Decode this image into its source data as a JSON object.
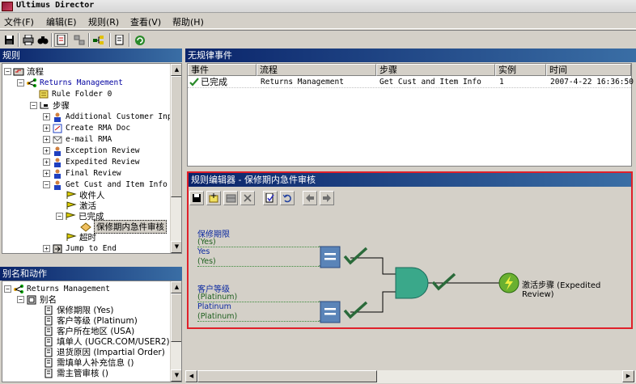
{
  "window": {
    "title": "Ultimus Director"
  },
  "menu": [
    {
      "label": "文件(F)"
    },
    {
      "label": "编辑(E)"
    },
    {
      "label": "规则(R)"
    },
    {
      "label": "查看(V)"
    },
    {
      "label": "帮助(H)"
    }
  ],
  "panes": {
    "rules_title": "规则",
    "events_title": "无规律事件",
    "editor_title": "规则编辑器 - 保修期内急件审核",
    "alias_title": "别名和动作"
  },
  "rules_tree": [
    {
      "label": "流程",
      "zh": true
    },
    {
      "label": "Returns Management",
      "color": "#0000a0"
    },
    {
      "label": "Rule Folder 0"
    },
    {
      "label": "步骤",
      "zh": true
    },
    {
      "label": "Additional Customer Inpu"
    },
    {
      "label": "Create RMA Doc"
    },
    {
      "label": "e-mail RMA"
    },
    {
      "label": "Exception Review"
    },
    {
      "label": "Expedited Review"
    },
    {
      "label": "Final Review"
    },
    {
      "label": "Get Cust and Item Info"
    },
    {
      "label": "收件人",
      "zh": true
    },
    {
      "label": "激活",
      "zh": true
    },
    {
      "label": "已完成",
      "zh": true
    },
    {
      "label": "保修期内急件审核",
      "zh": true
    },
    {
      "label": "超时",
      "zh": true
    },
    {
      "label": "Jump to End"
    }
  ],
  "events_table": {
    "columns": [
      "事件",
      "流程",
      "步骤",
      "实例",
      "时间"
    ],
    "rows": [
      [
        "已完成",
        "Returns Management",
        "Get Cust and Item Info",
        "1",
        "2007-4-22 16:36:50"
      ]
    ]
  },
  "alias_tree": [
    {
      "label": "Returns Management"
    },
    {
      "label": "别名",
      "zh": true
    },
    {
      "label": "保修期限 (Yes)"
    },
    {
      "label": "客户等级 (Platinum)"
    },
    {
      "label": "客户所在地区 (USA)"
    },
    {
      "label": "填单人 (UGCR.COM/USER2)"
    },
    {
      "label": "退货原因 (Impartial Order)"
    },
    {
      "label": "需填单人补充信息 ()"
    },
    {
      "label": "需主管审核 ()"
    }
  ],
  "rule_diagram": {
    "conditions": [
      {
        "name": "保修期限",
        "value1": "(Yes)",
        "value2": "Yes",
        "value3": "(Yes)"
      },
      {
        "name": "客户等级",
        "value1": "(Platinum)",
        "value2": "Platinum",
        "value3": "(Platinum)"
      }
    ],
    "action_label": "激活步骤 (Expedited Review)",
    "colors": {
      "gate": "#3aa88a",
      "check": "#2a6a3a",
      "equals": "#5a84b8",
      "action": "#6ab030"
    }
  }
}
